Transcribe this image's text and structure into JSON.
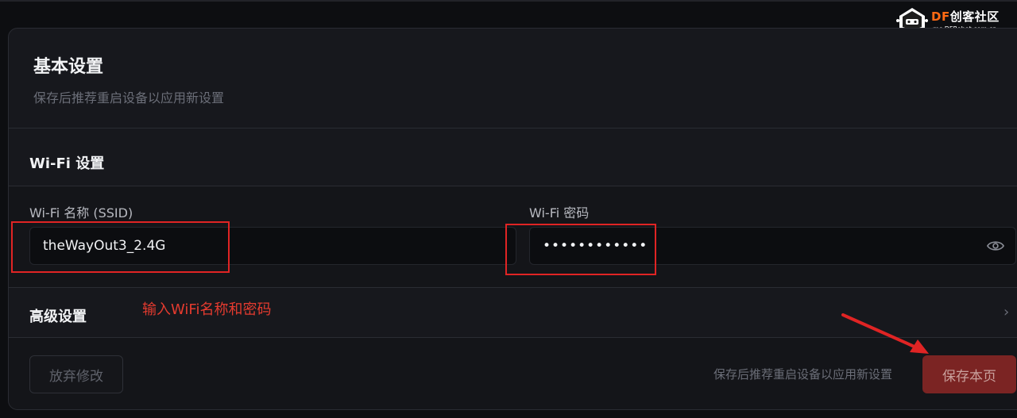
{
  "colors": {
    "accent_danger": "#7b2423",
    "annotation_red": "#e02424",
    "background": "#0d0e11",
    "card": "#17181d"
  },
  "logo": {
    "brand_prefix": "DF",
    "brand_suffix": "创客社区",
    "domain": "mc.DFRobot.com.cn"
  },
  "card": {
    "title": "基本设置",
    "subtitle": "保存后推荐重启设备以应用新设置"
  },
  "wifi": {
    "section_title": "Wi-Fi 设置",
    "ssid_label": "Wi-Fi 名称 (SSID)",
    "ssid_value": "theWayOut3_2.4G",
    "password_label": "Wi-Fi 密码",
    "password_value": "••••••••••••",
    "visibility_icon": "eye-icon"
  },
  "advanced": {
    "label": "高级设置",
    "chevron_icon": "chevron-right-icon"
  },
  "annotation": {
    "text": "输入WiFi名称和密码"
  },
  "footer": {
    "discard_label": "放弃修改",
    "hint": "保存后推荐重启设备以应用新设置",
    "save_label": "保存本页"
  }
}
